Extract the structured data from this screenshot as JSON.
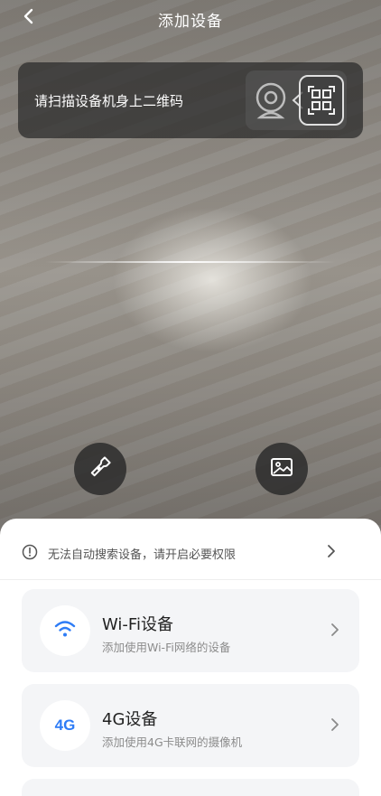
{
  "header": {
    "title": "添加设备",
    "back_icon": "chevron-left-icon"
  },
  "scan_hint": {
    "text": "请扫描设备机身上二维码",
    "illustration_icons": [
      "camera-device-icon",
      "qr-code-icon"
    ]
  },
  "controls": {
    "flashlight_icon": "flashlight-icon",
    "gallery_icon": "image-gallery-icon"
  },
  "permission_notice": {
    "icon": "info-circle-icon",
    "text": "无法自动搜索设备，请开启必要权限"
  },
  "device_types": [
    {
      "icon": "wifi-icon",
      "title": "Wi-Fi设备",
      "subtitle": "添加使用Wi-Fi网络的设备"
    },
    {
      "icon": "4g-icon",
      "icon_text": "4G",
      "title": "4G设备",
      "subtitle": "添加使用4G卡联网的摄像机"
    }
  ],
  "colors": {
    "accent": "#2e7cf6",
    "sheet_bg": "#ffffff",
    "card_bg": "#f4f5f7"
  }
}
